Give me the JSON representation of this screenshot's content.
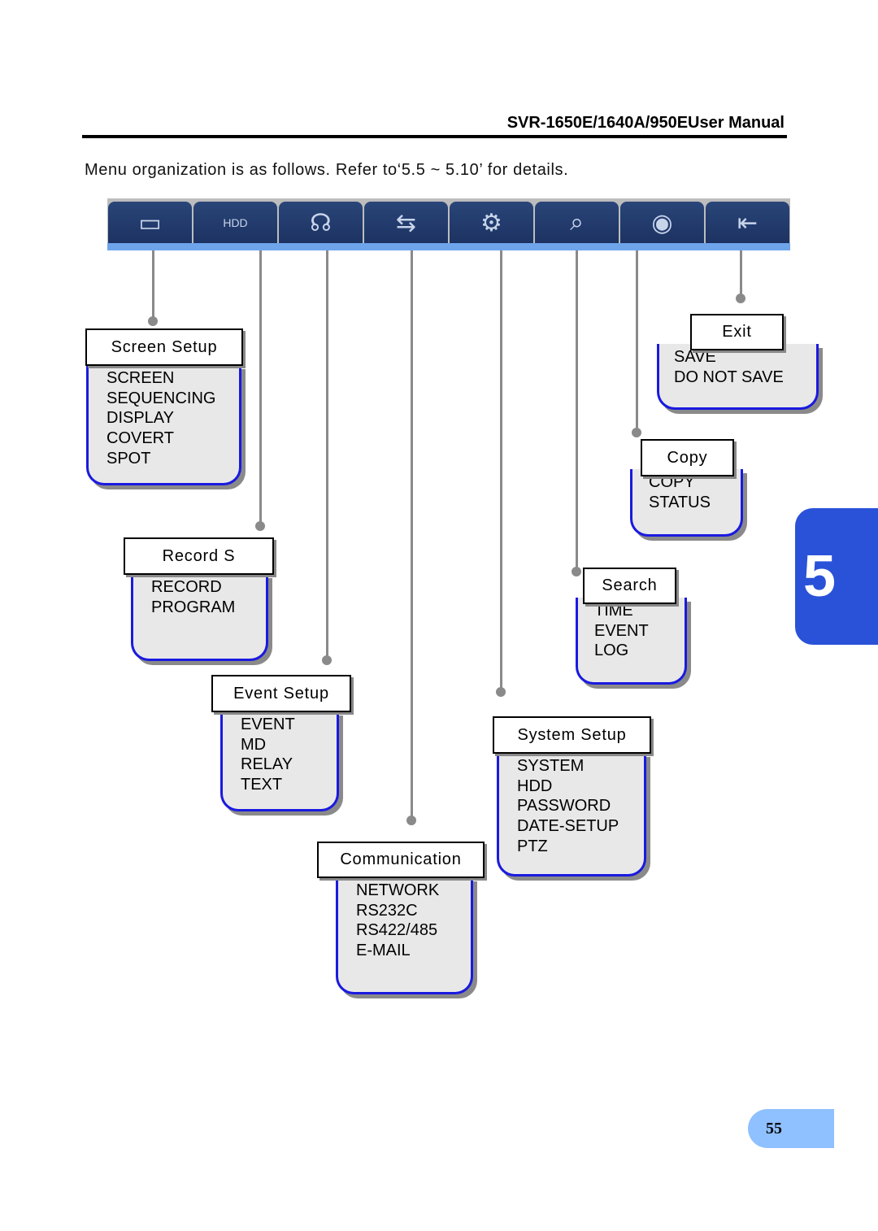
{
  "header": {
    "title": "SVR-1650E/1640A/950EUser Manual"
  },
  "intro": "Menu organization is as follows. Refer to‘5.5 ~ 5.10’ for details.",
  "toolbar": {
    "icons": [
      "monitor-icon",
      "hdd-icon",
      "event-person-icon",
      "network-icon",
      "system-tools-icon",
      "search-folder-icon",
      "copy-disc-icon",
      "exit-door-icon"
    ],
    "icon_glyphs": [
      "▭",
      "HDD",
      "☊",
      "⇆",
      "⚙",
      "⌕",
      "◉",
      "⇤"
    ]
  },
  "menus": [
    {
      "title": "Screen Setup",
      "items": [
        "SCREEN",
        "SEQUENCING",
        "DISPLAY",
        "COVERT",
        "SPOT"
      ]
    },
    {
      "title": "Record S",
      "items": [
        "RECORD",
        "PROGRAM"
      ]
    },
    {
      "title": "Event Setup",
      "items": [
        "EVENT",
        "MD",
        "RELAY",
        "TEXT"
      ]
    },
    {
      "title": "Communication",
      "items": [
        "NETWORK",
        "RS232C",
        "RS422/485",
        "E-MAIL"
      ]
    },
    {
      "title": "System Setup",
      "items": [
        "SYSTEM",
        "HDD",
        "PASSWORD",
        "DATE-SETUP",
        "PTZ"
      ]
    },
    {
      "title": "Search",
      "items": [
        "TIME",
        "EVENT",
        "LOG"
      ]
    },
    {
      "title": "Copy",
      "items": [
        "COPY",
        "STATUS"
      ]
    },
    {
      "title": "Exit",
      "items": [
        "SAVE",
        "DO NOT SAVE"
      ]
    }
  ],
  "chapter": "5",
  "page_number": "55",
  "colors": {
    "box_border": "#1a1ae0",
    "toolbar": "#1c3262",
    "chapter_tab": "#2a52d8",
    "page_tab": "#8fc0ff"
  }
}
